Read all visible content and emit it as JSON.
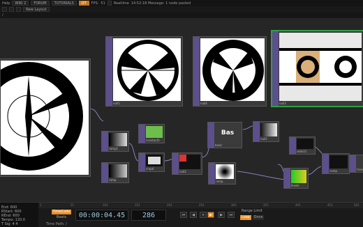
{
  "menu": {
    "help": "Help",
    "wiki": "WIKI 2",
    "forum": "FORUM",
    "tutorials": "TUTORIALS",
    "of": "OT",
    "fps_label": "FPS:",
    "fps": "51",
    "realtime": "Realtime",
    "message": "14:52:18 Message: 1 node pasted"
  },
  "tabs": {
    "new_layout": "New Layout"
  },
  "path": {
    "root": "/"
  },
  "nodes": {
    "n1": "null5",
    "n2": "null1",
    "n3": "null4",
    "n4": "null3",
    "ramp1": "ramp1",
    "ramp2": "ramp",
    "constant1": "constant1",
    "crop": "crop4",
    "null2": "null2",
    "basic": "basic",
    "bas": "Bas",
    "null_r": "null2",
    "select": "select1",
    "ramp3": "ramp",
    "levels": "levels",
    "comp": "comp",
    "xform": "transform1"
  },
  "timeline": {
    "ruler": [
      "1",
      "51",
      "101",
      "151",
      "201",
      "251",
      "301",
      "351",
      "401",
      "451",
      "501"
    ],
    "stats": [
      "End:  600",
      "RStart: 600",
      "REnd:  600",
      "Tempo: 120.0",
      "T Sig:  4   4"
    ],
    "timecode_label": "TimeCode",
    "beats_label": "Beats",
    "timecode": "00:00:04.45",
    "frame": "286",
    "range_limit": "Range Limit",
    "loop": "Loop",
    "once": "Once",
    "time_path": "Time Path: /"
  },
  "colors": {
    "accent": "#e8902c",
    "node_strip": "#5d4f8c",
    "selected": "#2ea043"
  }
}
